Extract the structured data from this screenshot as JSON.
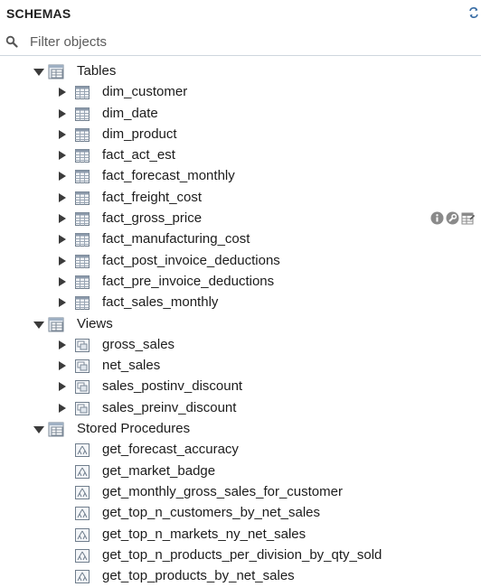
{
  "panel": {
    "title": "SCHEMAS",
    "refresh_icon": "refresh-icon"
  },
  "filter": {
    "placeholder": "Filter objects",
    "value": ""
  },
  "groups": [
    {
      "label": "Tables",
      "expanded": true,
      "items": [
        "dim_customer",
        "dim_date",
        "dim_product",
        "fact_act_est",
        "fact_forecast_monthly",
        "fact_freight_cost",
        "fact_gross_price",
        "fact_manufacturing_cost",
        "fact_post_invoice_deductions",
        "fact_pre_invoice_deductions",
        "fact_sales_monthly"
      ]
    },
    {
      "label": "Views",
      "expanded": true,
      "items": [
        "gross_sales",
        "net_sales",
        "sales_postinv_discount",
        "sales_preinv_discount"
      ]
    },
    {
      "label": "Stored Procedures",
      "expanded": true,
      "items": [
        "get_forecast_accuracy",
        "get_market_badge",
        "get_monthly_gross_sales_for_customer",
        "get_top_n_customers_by_net_sales",
        "get_top_n_markets_ny_net_sales",
        "get_top_n_products_per_division_by_qty_sold",
        "get_top_products_by_net_sales"
      ]
    }
  ],
  "hover_row": "fact_gross_price",
  "hover_actions": [
    "info-icon",
    "wrench-icon",
    "table-data-icon"
  ]
}
